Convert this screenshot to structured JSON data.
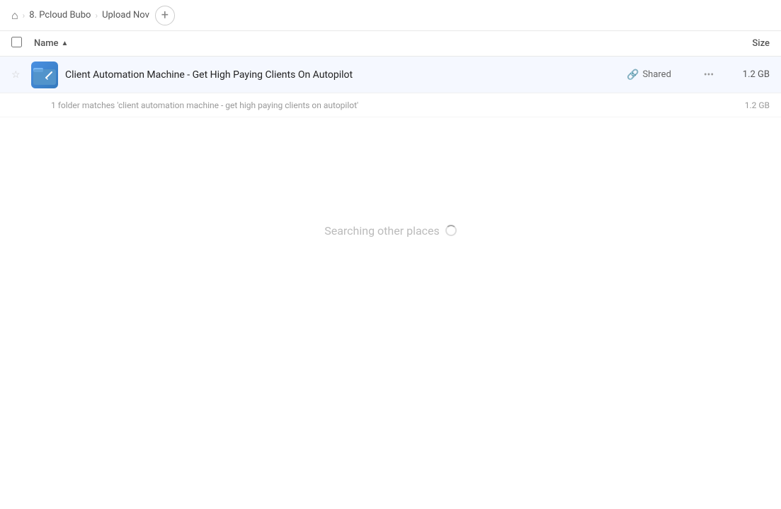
{
  "breadcrumb": {
    "home_icon": "🏠",
    "items": [
      {
        "label": "8. Pcloud Bubo",
        "active": false
      },
      {
        "label": "Upload Nov",
        "active": true
      }
    ],
    "add_button_label": "+"
  },
  "column_headers": {
    "checkbox_label": "",
    "name_label": "Name",
    "sort_indicator": "▲",
    "size_label": "Size"
  },
  "file_row": {
    "filename": "Client Automation Machine - Get High Paying Clients On Autopilot",
    "shared_label": "Shared",
    "size": "1.2 GB",
    "more_icon": "···"
  },
  "match_info": {
    "text": "1 folder matches 'client automation machine - get high paying clients on autopilot'",
    "size": "1.2 GB"
  },
  "searching": {
    "text": "Searching other places"
  }
}
